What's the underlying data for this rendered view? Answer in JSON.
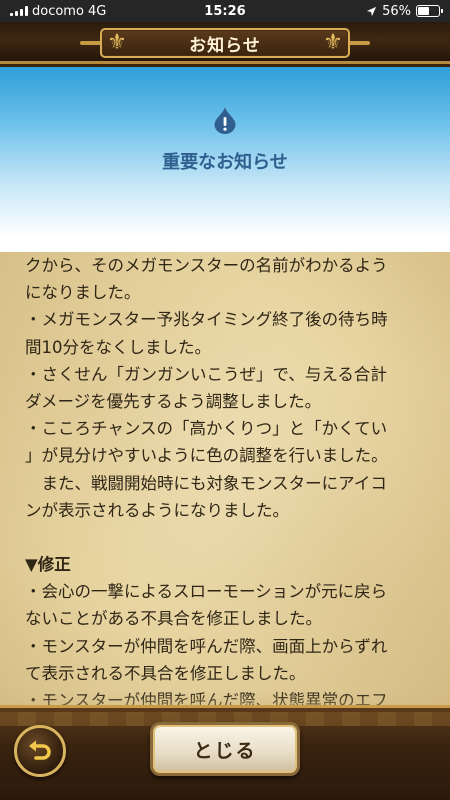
{
  "status_bar": {
    "carrier": "docomo",
    "network": "4G",
    "time": "15:26",
    "battery": "56%",
    "battery_level": 0.56
  },
  "header": {
    "title": "お知らせ"
  },
  "banner": {
    "icon": "slime-exclamation-icon",
    "title": "重要なお知らせ"
  },
  "content": {
    "lines": [
      "クから、そのメガモンスターの名前がわかるよう",
      "になりました。",
      "・メガモンスター予兆タイミング終了後の待ち時",
      "間10分をなくしました。",
      "・さくせん「ガンガンいこうぜ」で、与える合計",
      "ダメージを優先するよう調整しました。",
      "・こころチャンスの「高かくりつ」と「かくてい",
      "」が見分けやすいように色の調整を行いました。",
      "　また、戦闘開始時にも対象モンスターにアイコ",
      "ンが表示されるようになりました。",
      "",
      "▼修正",
      "・会心の一撃によるスローモーションが元に戻ら",
      "ないことがある不具合を修正しました。",
      "・モンスターが仲間を呼んだ際、画面上からずれ",
      "て表示される不具合を修正しました。",
      "・モンスターが仲間を呼んだ際、状態異常のエフ"
    ]
  },
  "footer": {
    "back_icon": "return-arrow-icon",
    "close_label": "とじる"
  },
  "colors": {
    "banner_title": "#2f5f8e",
    "text": "#2f2616",
    "gold_trim": "#d7ad55"
  }
}
